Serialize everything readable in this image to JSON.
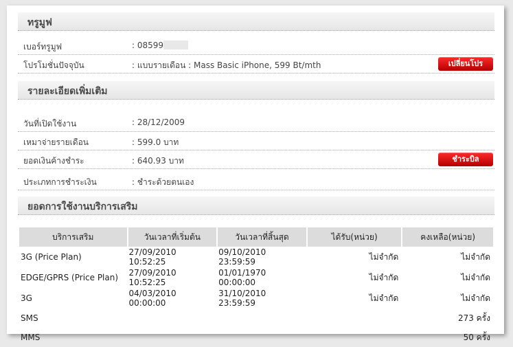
{
  "sections": {
    "truemove": "ทรูมูฟ",
    "details": "รายละเอียดเพิ่มเติม",
    "extra_services": "ยอดการใช้งานบริการเสริม"
  },
  "info": {
    "number_label": "เบอร์ทรูมูฟ",
    "number_value": ": 08599",
    "promo_label": "โปรโมชั่นปัจจุบัน",
    "promo_value": ": แบบรายเดือน : Mass Basic iPhone, 599 Bt/mth",
    "change_promo_button": "เปลี่ยนโปร"
  },
  "details": {
    "open_date_label": "วันที่เปิดใช้งาน",
    "open_date_value": ": 28/12/2009",
    "monthly_fee_label": "เหมาจ่ายรายเดือน",
    "monthly_fee_value": ": 599.0 บาท",
    "balance_label": "ยอดเงินค้างชำระ",
    "balance_value": ": 640.93 บาท",
    "pay_button": "ชำระบิล",
    "payment_type_label": "ประเภทการชำระเงิน",
    "payment_type_value": ": ชำระด้วยตนเอง"
  },
  "table": {
    "headers": [
      "บริการเสริม",
      "วันเวลาที่เริ่มต้น",
      "วันเวลาที่สิ้นสุด",
      "ได้รับ(หน่วย)",
      "คงเหลือ(หน่วย)"
    ],
    "rows": [
      [
        "3G (Price Plan)",
        "27/09/2010 10:52:25",
        "09/10/2010 23:59:59",
        "ไม่จำกัด",
        "ไม่จำกัด"
      ],
      [
        "EDGE/GPRS (Price Plan)",
        "27/09/2010 10:52:25",
        "01/01/1970 00:00:00",
        "ไม่จำกัด",
        "ไม่จำกัด"
      ],
      [
        "3G",
        "04/03/2010 00:00:00",
        "31/10/2010 23:59:59",
        "ไม่จำกัด",
        "ไม่จำกัด"
      ],
      [
        "SMS",
        "",
        "",
        "",
        "273 ครั้ง"
      ],
      [
        "MMS",
        "",
        "",
        "",
        "50 ครั้ง"
      ]
    ]
  }
}
